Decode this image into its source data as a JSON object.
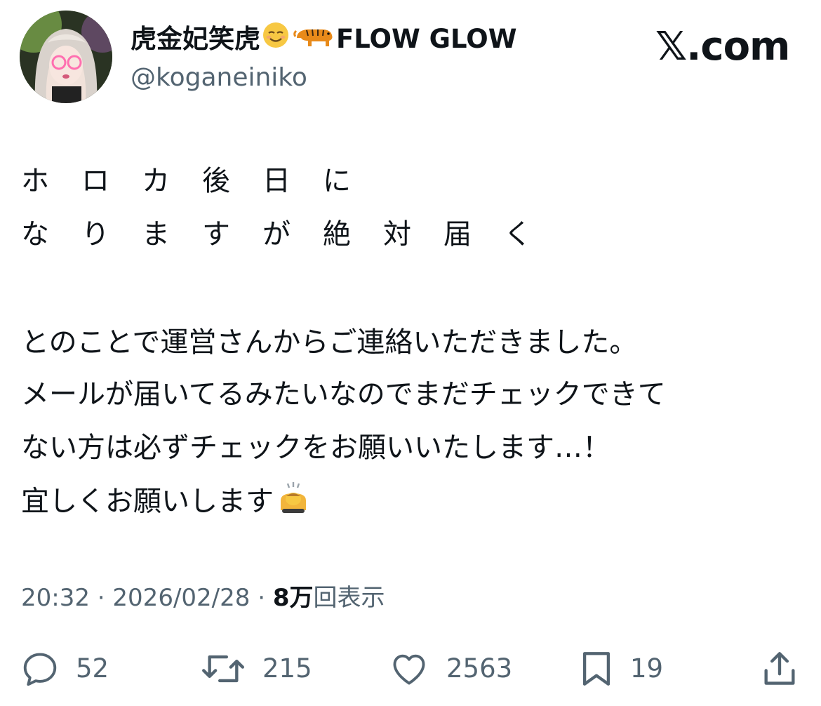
{
  "header": {
    "display_name": "虎金妃笑虎",
    "display_name_suffix": "FLOW GLOW",
    "handle": "@koganeiniko",
    "brand": "𝕏.com"
  },
  "post": {
    "spaced_line_1": "ホロカ後日に",
    "spaced_line_2": "なりますが絶対届く",
    "paragraph_1": "とのことで運営さんからご連絡いただきました。",
    "paragraph_2": "メールが届いてるみたいなのでまだチェックできて",
    "paragraph_3": "ない方は必ずチェックをお願いいたします…！",
    "paragraph_4": "宜しくお願いします"
  },
  "meta": {
    "time": "20:32",
    "separator": "·",
    "date": "2026/02/28",
    "views_count": "8万",
    "views_label": "回表示"
  },
  "actions": {
    "reply_count": "52",
    "retweet_count": "215",
    "like_count": "2563",
    "bookmark_count": "19"
  },
  "icons": {
    "name_emoji_1": "smiling-face-emoji",
    "name_emoji_2": "tiger-emoji",
    "body_emoji": "person-bowing-emoji",
    "reply": "reply-icon",
    "retweet": "retweet-icon",
    "like": "heart-icon",
    "bookmark": "bookmark-icon",
    "share": "share-icon"
  },
  "colors": {
    "text": "#0f1419",
    "secondary": "#536471",
    "background": "#ffffff"
  }
}
